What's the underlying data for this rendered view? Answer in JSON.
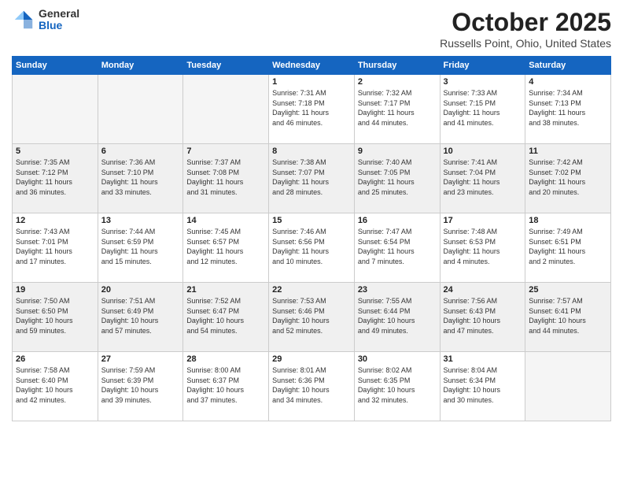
{
  "header": {
    "logo_general": "General",
    "logo_blue": "Blue",
    "month_title": "October 2025",
    "location": "Russells Point, Ohio, United States"
  },
  "days_of_week": [
    "Sunday",
    "Monday",
    "Tuesday",
    "Wednesday",
    "Thursday",
    "Friday",
    "Saturday"
  ],
  "weeks": [
    [
      {
        "day": "",
        "info": "",
        "empty": true
      },
      {
        "day": "",
        "info": "",
        "empty": true
      },
      {
        "day": "",
        "info": "",
        "empty": true
      },
      {
        "day": "1",
        "info": "Sunrise: 7:31 AM\nSunset: 7:18 PM\nDaylight: 11 hours\nand 46 minutes."
      },
      {
        "day": "2",
        "info": "Sunrise: 7:32 AM\nSunset: 7:17 PM\nDaylight: 11 hours\nand 44 minutes."
      },
      {
        "day": "3",
        "info": "Sunrise: 7:33 AM\nSunset: 7:15 PM\nDaylight: 11 hours\nand 41 minutes."
      },
      {
        "day": "4",
        "info": "Sunrise: 7:34 AM\nSunset: 7:13 PM\nDaylight: 11 hours\nand 38 minutes."
      }
    ],
    [
      {
        "day": "5",
        "info": "Sunrise: 7:35 AM\nSunset: 7:12 PM\nDaylight: 11 hours\nand 36 minutes.",
        "shaded": true
      },
      {
        "day": "6",
        "info": "Sunrise: 7:36 AM\nSunset: 7:10 PM\nDaylight: 11 hours\nand 33 minutes.",
        "shaded": true
      },
      {
        "day": "7",
        "info": "Sunrise: 7:37 AM\nSunset: 7:08 PM\nDaylight: 11 hours\nand 31 minutes.",
        "shaded": true
      },
      {
        "day": "8",
        "info": "Sunrise: 7:38 AM\nSunset: 7:07 PM\nDaylight: 11 hours\nand 28 minutes.",
        "shaded": true
      },
      {
        "day": "9",
        "info": "Sunrise: 7:40 AM\nSunset: 7:05 PM\nDaylight: 11 hours\nand 25 minutes.",
        "shaded": true
      },
      {
        "day": "10",
        "info": "Sunrise: 7:41 AM\nSunset: 7:04 PM\nDaylight: 11 hours\nand 23 minutes.",
        "shaded": true
      },
      {
        "day": "11",
        "info": "Sunrise: 7:42 AM\nSunset: 7:02 PM\nDaylight: 11 hours\nand 20 minutes.",
        "shaded": true
      }
    ],
    [
      {
        "day": "12",
        "info": "Sunrise: 7:43 AM\nSunset: 7:01 PM\nDaylight: 11 hours\nand 17 minutes."
      },
      {
        "day": "13",
        "info": "Sunrise: 7:44 AM\nSunset: 6:59 PM\nDaylight: 11 hours\nand 15 minutes."
      },
      {
        "day": "14",
        "info": "Sunrise: 7:45 AM\nSunset: 6:57 PM\nDaylight: 11 hours\nand 12 minutes."
      },
      {
        "day": "15",
        "info": "Sunrise: 7:46 AM\nSunset: 6:56 PM\nDaylight: 11 hours\nand 10 minutes."
      },
      {
        "day": "16",
        "info": "Sunrise: 7:47 AM\nSunset: 6:54 PM\nDaylight: 11 hours\nand 7 minutes."
      },
      {
        "day": "17",
        "info": "Sunrise: 7:48 AM\nSunset: 6:53 PM\nDaylight: 11 hours\nand 4 minutes."
      },
      {
        "day": "18",
        "info": "Sunrise: 7:49 AM\nSunset: 6:51 PM\nDaylight: 11 hours\nand 2 minutes."
      }
    ],
    [
      {
        "day": "19",
        "info": "Sunrise: 7:50 AM\nSunset: 6:50 PM\nDaylight: 10 hours\nand 59 minutes.",
        "shaded": true
      },
      {
        "day": "20",
        "info": "Sunrise: 7:51 AM\nSunset: 6:49 PM\nDaylight: 10 hours\nand 57 minutes.",
        "shaded": true
      },
      {
        "day": "21",
        "info": "Sunrise: 7:52 AM\nSunset: 6:47 PM\nDaylight: 10 hours\nand 54 minutes.",
        "shaded": true
      },
      {
        "day": "22",
        "info": "Sunrise: 7:53 AM\nSunset: 6:46 PM\nDaylight: 10 hours\nand 52 minutes.",
        "shaded": true
      },
      {
        "day": "23",
        "info": "Sunrise: 7:55 AM\nSunset: 6:44 PM\nDaylight: 10 hours\nand 49 minutes.",
        "shaded": true
      },
      {
        "day": "24",
        "info": "Sunrise: 7:56 AM\nSunset: 6:43 PM\nDaylight: 10 hours\nand 47 minutes.",
        "shaded": true
      },
      {
        "day": "25",
        "info": "Sunrise: 7:57 AM\nSunset: 6:41 PM\nDaylight: 10 hours\nand 44 minutes.",
        "shaded": true
      }
    ],
    [
      {
        "day": "26",
        "info": "Sunrise: 7:58 AM\nSunset: 6:40 PM\nDaylight: 10 hours\nand 42 minutes."
      },
      {
        "day": "27",
        "info": "Sunrise: 7:59 AM\nSunset: 6:39 PM\nDaylight: 10 hours\nand 39 minutes."
      },
      {
        "day": "28",
        "info": "Sunrise: 8:00 AM\nSunset: 6:37 PM\nDaylight: 10 hours\nand 37 minutes."
      },
      {
        "day": "29",
        "info": "Sunrise: 8:01 AM\nSunset: 6:36 PM\nDaylight: 10 hours\nand 34 minutes."
      },
      {
        "day": "30",
        "info": "Sunrise: 8:02 AM\nSunset: 6:35 PM\nDaylight: 10 hours\nand 32 minutes."
      },
      {
        "day": "31",
        "info": "Sunrise: 8:04 AM\nSunset: 6:34 PM\nDaylight: 10 hours\nand 30 minutes."
      },
      {
        "day": "",
        "info": "",
        "empty": true
      }
    ]
  ]
}
